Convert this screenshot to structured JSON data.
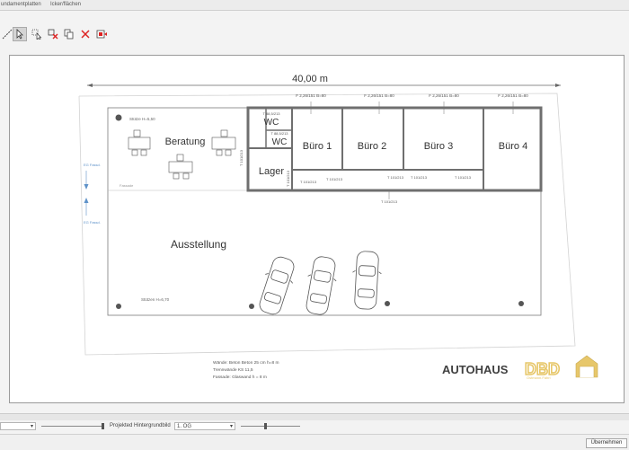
{
  "tabs": {
    "tab1": "undamentplatten",
    "tab2": "Icker/flächen"
  },
  "plan": {
    "dimension": "40,00 m",
    "rooms": {
      "beratung": "Beratung",
      "wc1": "WC",
      "wc2": "WC",
      "buero1": "Büro 1",
      "buero2": "Büro 2",
      "buero3": "Büro 3",
      "buero4": "Büro 4",
      "lager": "Lager",
      "ausstellung": "Ausstellung"
    },
    "windows": {
      "f1": "F 2,26/151 B=80",
      "f2": "F 2,26/151 B=80",
      "f3": "F 2,26/151 B=80",
      "f4": "F 2,26/151 B=80"
    },
    "doors": {
      "t1": "T 101/213",
      "t2": "T 101/213",
      "t3": "T 101/213",
      "t4": "T 101/213",
      "t5": "T 101/213",
      "t6": "T 101/213",
      "t7": "T 101/213",
      "t8": "T 101/213",
      "t9": "T 88,5/213",
      "t10": "T 88,5/213"
    },
    "notes": {
      "stuetze_top": "Stütze H=5,50",
      "stuetze_bottom": "Stützen H=6,70",
      "fassade": "Fassade",
      "level1": "EG Fassd.",
      "level2": "EG Fassd."
    },
    "legend": {
      "line1": "Wände: Beton Beton 25 cm h=8 m",
      "line2": "Trennwände KS 11,5",
      "line3": "Fassade: Glaswand h = 8 m"
    },
    "logo": {
      "brand": "AUTOHAUS",
      "mark": "DBD",
      "tagline": "Ostmann.Fahrl"
    }
  },
  "bottombar": {
    "select1": "",
    "bg_label": "Projekted Hintergrundbild",
    "select2": "1. OG"
  },
  "status": {
    "apply_button": "Übernehmen"
  },
  "colors": {
    "wall": "#6f6f6f",
    "logo_gold": "#e7c76a",
    "level_blue": "#5f92c9",
    "dark_text": "#404040"
  }
}
